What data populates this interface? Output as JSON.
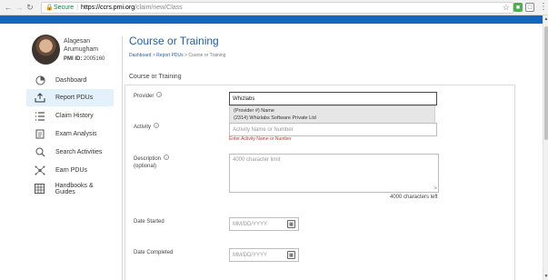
{
  "browser": {
    "secure_label": "Secure",
    "url_host": "https://ccrs.pmi.org",
    "url_path": "/claim/new/Class"
  },
  "user": {
    "name": "Alagesan Arumugham",
    "pmi_label": "PMI ID:",
    "pmi_id": "2005160"
  },
  "sidebar": {
    "items": [
      {
        "label": "Dashboard",
        "icon": "dashboard-icon"
      },
      {
        "label": "Report PDUs",
        "icon": "upload-tray-icon",
        "active": true
      },
      {
        "label": "Claim History",
        "icon": "list-icon"
      },
      {
        "label": "Exam Analysis",
        "icon": "document-icon"
      },
      {
        "label": "Search Activities",
        "icon": "search-icon"
      },
      {
        "label": "Earn PDUs",
        "icon": "network-icon"
      },
      {
        "label": "Handbooks & Guides",
        "icon": "grid-icon"
      }
    ]
  },
  "main": {
    "title": "Course or Training",
    "breadcrumb": {
      "dashboard": "Dashboard",
      "report": "Report PDUs",
      "current": "Course or Training"
    },
    "section_title": "Course or Training",
    "form": {
      "provider": {
        "label": "Provider",
        "value": "Whizlabs",
        "suggest_header": "(Provider #) Name",
        "suggest_item": "(2314) Whizlabs Software Private Ltd"
      },
      "activity": {
        "label": "Activity",
        "placeholder": "Activity Name or Number",
        "error": "Enter Activity Name or Number"
      },
      "description": {
        "label": "Description",
        "sublabel": "(optional)",
        "placeholder": "4000 character limit",
        "count": "4000 characters left"
      },
      "date_started": {
        "label": "Date Started",
        "placeholder": "MM/DD/YYYY"
      },
      "date_completed": {
        "label": "Date Completed",
        "placeholder": "MM/DD/YYYY"
      }
    }
  },
  "colors": {
    "brand_blue": "#1565c0",
    "title_blue": "#1f5ea8",
    "error_red": "#d32f2f",
    "active_bg": "#e3f1fb"
  }
}
